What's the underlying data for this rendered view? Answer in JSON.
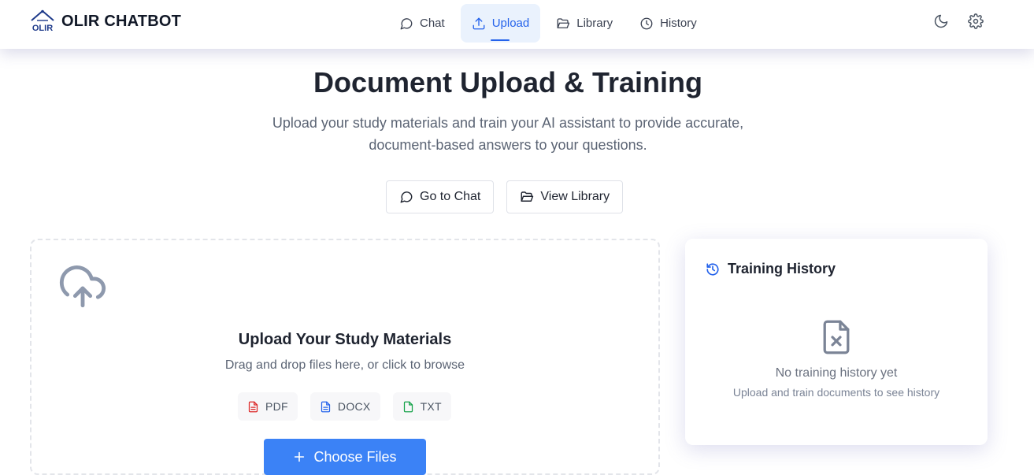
{
  "app": {
    "brand": "OLIR CHATBOT",
    "logo_text": "OLIR"
  },
  "nav": {
    "items": [
      {
        "label": "Chat",
        "icon": "message-circle-icon"
      },
      {
        "label": "Upload",
        "icon": "upload-icon",
        "active": true
      },
      {
        "label": "Library",
        "icon": "folder-open-icon"
      },
      {
        "label": "History",
        "icon": "clock-icon"
      }
    ]
  },
  "header_icons": [
    "moon-icon",
    "gear-icon"
  ],
  "hero": {
    "title": "Document Upload & Training",
    "subtitle_line1": "Upload your study materials and train your AI assistant to provide accurate,",
    "subtitle_line2": "document-based answers to your questions.",
    "actions": [
      {
        "label": "Go to Chat",
        "icon": "message-circle-icon"
      },
      {
        "label": "View Library",
        "icon": "folder-open-icon"
      }
    ]
  },
  "upload": {
    "title": "Upload Your Study Materials",
    "subtitle": "Drag and drop files here, or click to browse",
    "file_types": [
      {
        "label": "PDF",
        "color": "#dc2626"
      },
      {
        "label": "DOCX",
        "color": "#2563eb"
      },
      {
        "label": "TXT",
        "color": "#16a34a"
      }
    ],
    "button_label": "Choose Files"
  },
  "training_history": {
    "title": "Training History",
    "empty_title": "No training history yet",
    "empty_subtitle": "Upload and train documents to see history"
  },
  "colors": {
    "accent": "#2563eb",
    "button": "#3b82f6",
    "active_tab_bg": "#eaf2fd"
  }
}
